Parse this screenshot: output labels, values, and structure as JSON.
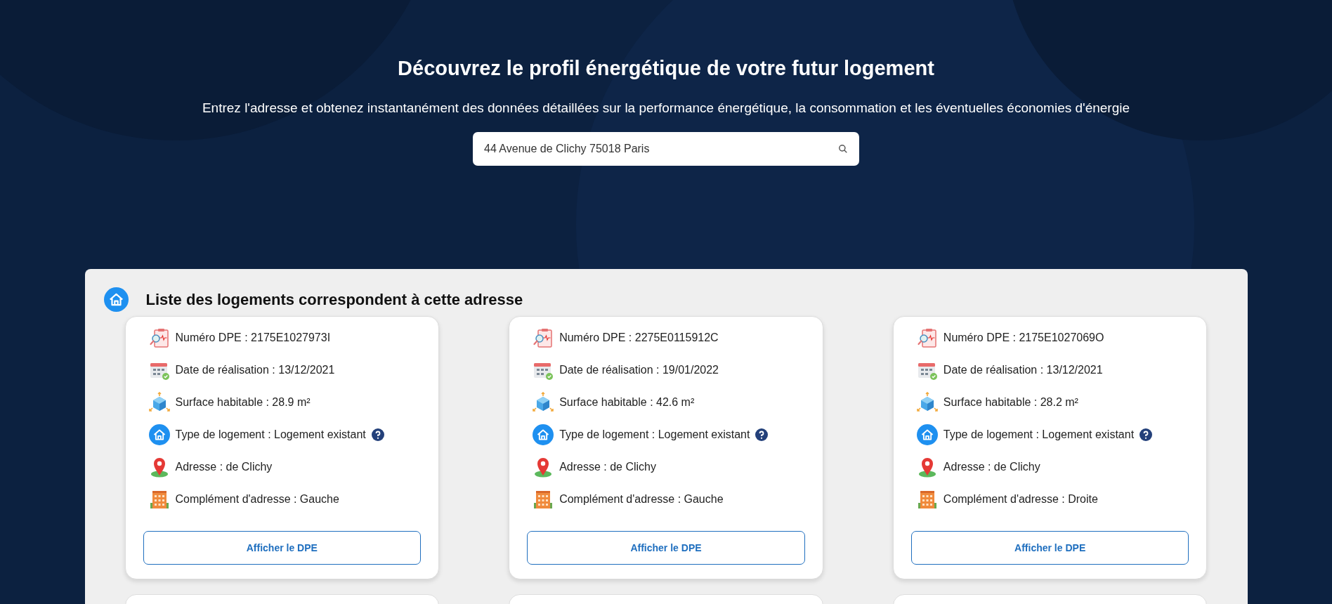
{
  "hero": {
    "title": "Découvrez le profil énergétique de votre futur logement",
    "subtitle": "Entrez l'adresse et obtenez instantanément des données détaillées sur la performance énergétique, la consommation et les éventuelles économies d'énergie"
  },
  "search": {
    "value": "44 Avenue de Clichy 75018 Paris"
  },
  "results": {
    "title": "Liste des logements correspondent à cette adresse",
    "cards": [
      {
        "fields": [
          {
            "kind": "dpe",
            "text": "Numéro DPE : 2175E1027973I"
          },
          {
            "kind": "date",
            "text": "Date de réalisation : 13/12/2021"
          },
          {
            "kind": "surface",
            "text": "Surface habitable : 28.9 m²"
          },
          {
            "kind": "type",
            "text": "Type de logement : Logement existant"
          },
          {
            "kind": "address",
            "text": "Adresse : de Clichy"
          },
          {
            "kind": "complement",
            "text": "Complément d'adresse : Gauche"
          }
        ],
        "button": "Afficher le DPE"
      },
      {
        "fields": [
          {
            "kind": "dpe",
            "text": "Numéro DPE : 2275E0115912C"
          },
          {
            "kind": "date",
            "text": "Date de réalisation : 19/01/2022"
          },
          {
            "kind": "surface",
            "text": "Surface habitable : 42.6 m²"
          },
          {
            "kind": "type",
            "text": "Type de logement : Logement existant"
          },
          {
            "kind": "address",
            "text": "Adresse : de Clichy"
          },
          {
            "kind": "complement",
            "text": "Complément d'adresse : Gauche"
          }
        ],
        "button": "Afficher le DPE"
      },
      {
        "fields": [
          {
            "kind": "dpe",
            "text": "Numéro DPE : 2175E1027069O"
          },
          {
            "kind": "date",
            "text": "Date de réalisation : 13/12/2021"
          },
          {
            "kind": "surface",
            "text": "Surface habitable : 28.2 m²"
          },
          {
            "kind": "type",
            "text": "Type de logement : Logement existant"
          },
          {
            "kind": "address",
            "text": "Adresse : de Clichy"
          },
          {
            "kind": "complement",
            "text": "Complément d'adresse : Droite"
          }
        ],
        "button": "Afficher le DPE"
      }
    ]
  }
}
